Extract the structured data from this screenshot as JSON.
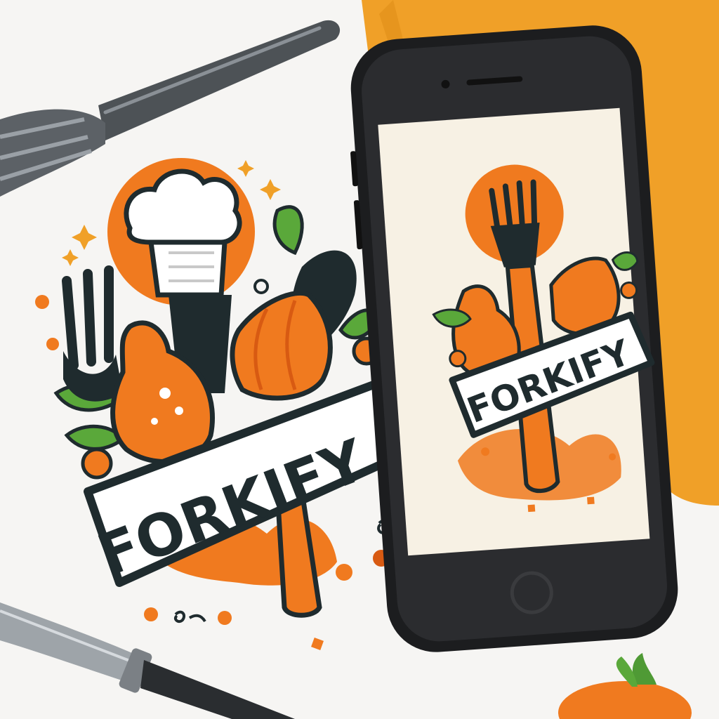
{
  "scene": {
    "description_free": true,
    "colors": {
      "background": "#f6f5f3",
      "orange": "#f07a1f",
      "orange_dark": "#d85a12",
      "napkin": "#f0a028",
      "dark": "#1f2b2e",
      "green": "#5aa83a",
      "white": "#ffffff",
      "screen": "#f7f1e4",
      "metal": "#6b6f73"
    }
  },
  "logo_main": {
    "wordmark": "FORKIFY"
  },
  "phone": {
    "screen_logo": {
      "wordmark": "FORKIFY"
    }
  },
  "icons": {
    "fork": "fork-icon",
    "knife": "knife-icon",
    "chef_hat": "chef-hat-icon",
    "phone": "smartphone-icon"
  }
}
